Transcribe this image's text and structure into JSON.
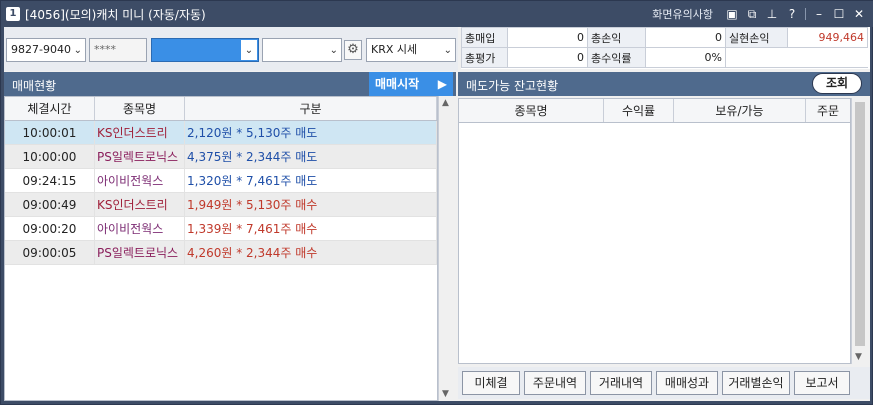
{
  "window": {
    "number": "1",
    "title": "[4056](모의)캐치 미니 (자동/자동)",
    "notice_link": "화면유의사항"
  },
  "controls": {
    "account": "9827-9040",
    "password": "****",
    "blue_select": "",
    "empty_select": "",
    "market_select": "KRX 시세"
  },
  "summary": {
    "total_buy_label": "총매입",
    "total_buy_value": "0",
    "total_pl_label": "총손익",
    "total_pl_value": "0",
    "realized_label": "실현손익",
    "realized_value": "949,464",
    "total_eval_label": "총평가",
    "total_eval_value": "0",
    "total_rate_label": "총수익률",
    "total_rate_value": "0%"
  },
  "left": {
    "title": "매매현황",
    "start_button": "매매시작",
    "columns": [
      "체결시간",
      "종목명",
      "구분"
    ],
    "rows": [
      {
        "time": "10:00:01",
        "name": "KS인더스트리",
        "detail": "2,120원 * 5,130주 매도",
        "side": "sell",
        "name_color": "ks"
      },
      {
        "time": "10:00:00",
        "name": "PS일렉트로닉스",
        "detail": "4,375원 * 2,344주 매도",
        "side": "sell",
        "name_color": "ps"
      },
      {
        "time": "09:24:15",
        "name": "아이비전웍스",
        "detail": "1,320원 * 7,461주 매도",
        "side": "sell",
        "name_color": "ai"
      },
      {
        "time": "09:00:49",
        "name": "KS인더스트리",
        "detail": "1,949원 * 5,130주 매수",
        "side": "buy",
        "name_color": "ks"
      },
      {
        "time": "09:00:20",
        "name": "아이비전웍스",
        "detail": "1,339원 * 7,461주 매수",
        "side": "buy",
        "name_color": "ai"
      },
      {
        "time": "09:00:05",
        "name": "PS일렉트로닉스",
        "detail": "4,260원 * 2,344주 매수",
        "side": "buy",
        "name_color": "ps"
      }
    ]
  },
  "right": {
    "title": "매도가능 잔고현황",
    "query_button": "조회",
    "columns": [
      "종목명",
      "수익률",
      "보유/가능",
      "주문"
    ],
    "buttons": [
      "미체결",
      "주문내역",
      "거래내역",
      "매매성과",
      "거래별손익",
      "보고서"
    ]
  }
}
